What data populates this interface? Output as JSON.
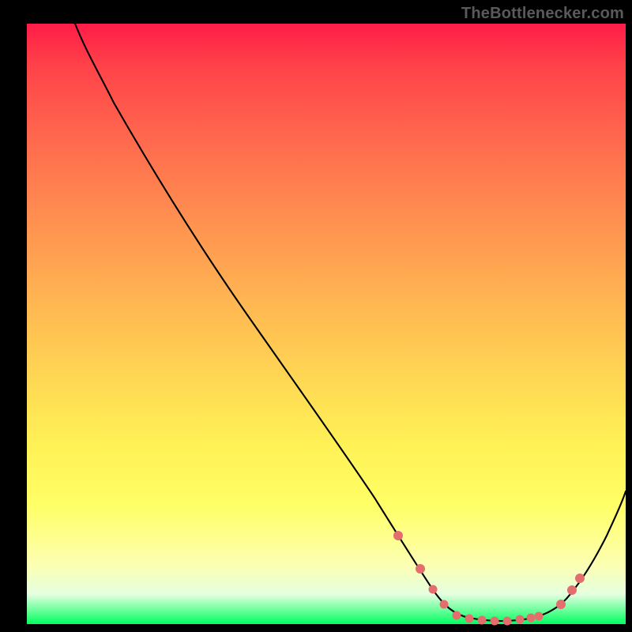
{
  "attribution": "TheBottlenecker.com",
  "colors": {
    "page_bg": "#000000",
    "gradient_top": "#ff1c48",
    "gradient_bottom": "#00ff5f",
    "curve": "#000000",
    "points": "#e46e6e",
    "attribution_text": "#5a5a5a"
  },
  "chart_data": {
    "type": "line",
    "title": "",
    "xlabel": "",
    "ylabel": "",
    "xlim": [
      0,
      100
    ],
    "ylim": [
      0,
      100
    ],
    "series": [
      {
        "name": "bottleneck-curve",
        "x": [
          8,
          12,
          20,
          30,
          40,
          50,
          58,
          62,
          66,
          70,
          74,
          78,
          82,
          86,
          90,
          94,
          100
        ],
        "y": [
          100,
          96,
          85,
          71,
          57,
          43,
          32,
          25,
          17,
          8,
          2,
          0,
          0,
          1,
          3,
          8,
          23
        ]
      }
    ],
    "highlight_points": {
      "x": [
        62,
        66,
        68,
        70,
        72,
        74,
        76,
        78,
        80,
        82,
        84,
        85,
        89,
        91,
        92
      ],
      "y": [
        25,
        16,
        11,
        8,
        4,
        2,
        1,
        0.5,
        0.3,
        0.3,
        0.7,
        1,
        3,
        6,
        8
      ]
    },
    "note": "Axis values are relative estimates (0–100) read from the unlabeled plot; the curve's minimum is near x≈80 with y≈0."
  }
}
